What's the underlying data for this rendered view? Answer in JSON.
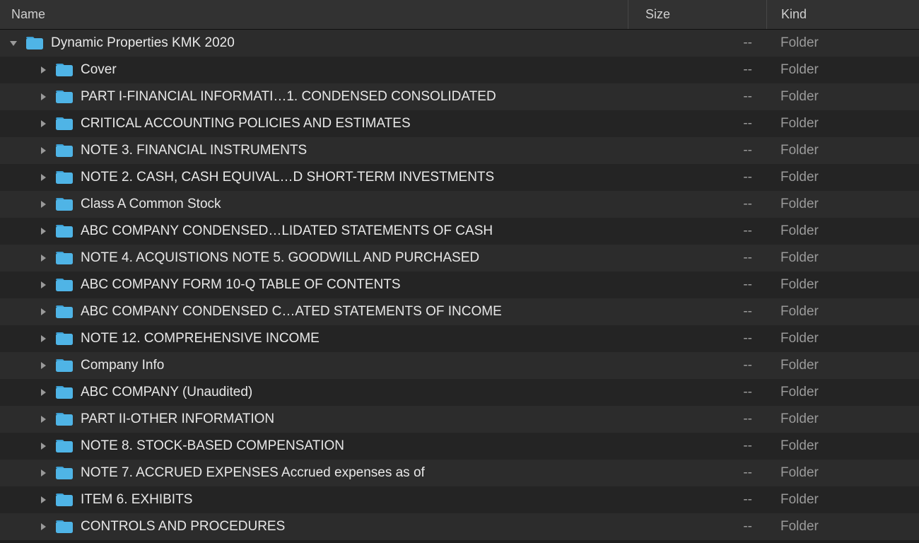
{
  "columns": {
    "name": "Name",
    "size": "Size",
    "kind": "Kind"
  },
  "colors": {
    "folder_fill": "#4FB4E6",
    "folder_tab": "#3B9FD4",
    "arrow": "#9a9a9a"
  },
  "rows": [
    {
      "indent": 0,
      "expanded": true,
      "name": "Dynamic Properties KMK 2020",
      "size": "--",
      "kind": "Folder"
    },
    {
      "indent": 1,
      "expanded": false,
      "name": "Cover",
      "size": "--",
      "kind": "Folder"
    },
    {
      "indent": 1,
      "expanded": false,
      "name": "PART I-FINANCIAL INFORMATI…1. CONDENSED CONSOLIDATED",
      "size": "--",
      "kind": "Folder"
    },
    {
      "indent": 1,
      "expanded": false,
      "name": "CRITICAL ACCOUNTING POLICIES AND ESTIMATES",
      "size": "--",
      "kind": "Folder"
    },
    {
      "indent": 1,
      "expanded": false,
      "name": "NOTE 3. FINANCIAL INSTRUMENTS",
      "size": "--",
      "kind": "Folder"
    },
    {
      "indent": 1,
      "expanded": false,
      "name": "NOTE 2. CASH, CASH EQUIVAL…D SHORT-TERM INVESTMENTS",
      "size": "--",
      "kind": "Folder"
    },
    {
      "indent": 1,
      "expanded": false,
      "name": "Class A Common Stock",
      "size": "--",
      "kind": "Folder"
    },
    {
      "indent": 1,
      "expanded": false,
      "name": " ABC COMPANY CONDENSED…LIDATED STATEMENTS OF CASH",
      "size": "--",
      "kind": "Folder"
    },
    {
      "indent": 1,
      "expanded": false,
      "name": "NOTE 4. ACQUISTIONS   NOTE 5. GOODWILL AND PURCHASED",
      "size": "--",
      "kind": "Folder"
    },
    {
      "indent": 1,
      "expanded": false,
      "name": "ABC COMPANY FORM 10-Q TABLE OF CONTENTS",
      "size": "--",
      "kind": "Folder"
    },
    {
      "indent": 1,
      "expanded": false,
      "name": "ABC COMPANY CONDENSED C…ATED STATEMENTS OF INCOME",
      "size": "--",
      "kind": "Folder"
    },
    {
      "indent": 1,
      "expanded": false,
      "name": "NOTE 12. COMPREHENSIVE INCOME",
      "size": "--",
      "kind": "Folder"
    },
    {
      "indent": 1,
      "expanded": false,
      "name": "Company Info",
      "size": "--",
      "kind": "Folder"
    },
    {
      "indent": 1,
      "expanded": false,
      "name": "ABC COMPANY  (Unaudited)",
      "size": "--",
      "kind": "Folder"
    },
    {
      "indent": 1,
      "expanded": false,
      "name": "PART II-OTHER INFORMATION",
      "size": "--",
      "kind": "Folder"
    },
    {
      "indent": 1,
      "expanded": false,
      "name": "NOTE 8. STOCK-BASED COMPENSATION",
      "size": "--",
      "kind": "Folder"
    },
    {
      "indent": 1,
      "expanded": false,
      "name": "NOTE 7. ACCRUED EXPENSES   Accrued expenses as of",
      "size": "--",
      "kind": "Folder"
    },
    {
      "indent": 1,
      "expanded": false,
      "name": "ITEM 6. EXHIBITS",
      "size": "--",
      "kind": "Folder"
    },
    {
      "indent": 1,
      "expanded": false,
      "name": "CONTROLS AND PROCEDURES",
      "size": "--",
      "kind": "Folder"
    }
  ]
}
